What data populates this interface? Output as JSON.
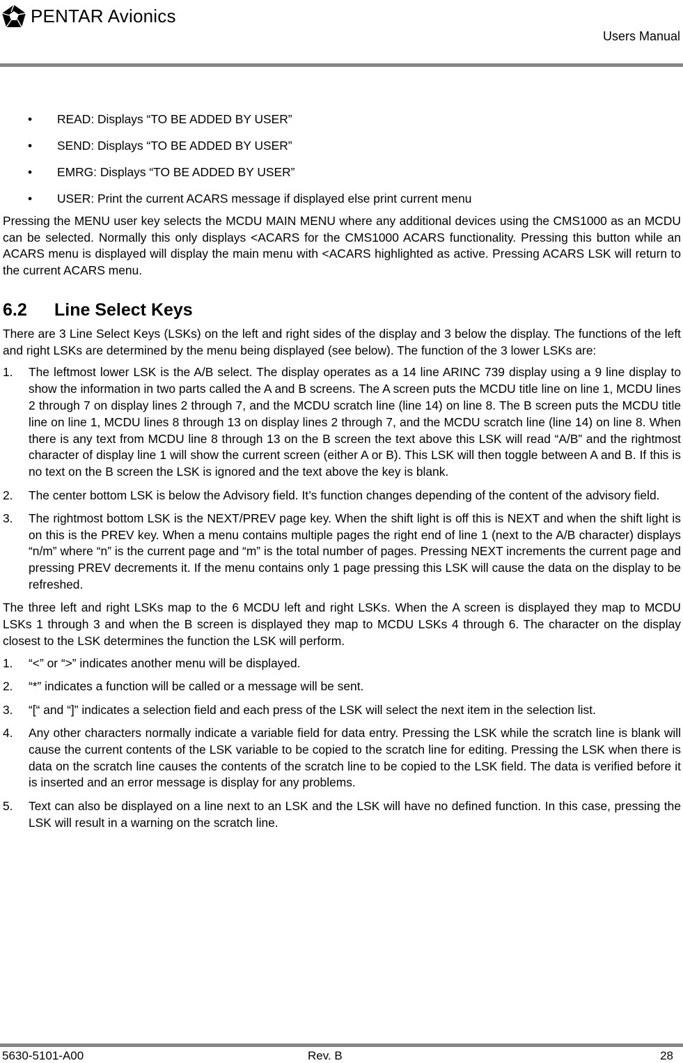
{
  "header": {
    "brand": "PENTAR Avionics",
    "logo_icon": "pentagon-aperture-logo",
    "doc_type": "Users Manual"
  },
  "bullets": [
    "READ:  Displays “TO BE ADDED BY USER”",
    "SEND:  Displays “TO BE ADDED BY USER”",
    "EMRG: Displays “TO BE ADDED BY USER”",
    "USER:  Print the current ACARS message if displayed else print current menu"
  ],
  "menu_paragraph": "Pressing the MENU user key selects the MCDU MAIN MENU where any additional devices using the CMS1000 as an MCDU can be selected.  Normally this only displays <ACARS for the CMS1000 ACARS functionality.  Pressing this button while an ACARS menu is displayed will display the main menu with <ACARS highlighted as active.  Pressing ACARS LSK will return to the current ACARS menu.",
  "section": {
    "number": "6.2",
    "title": "Line Select Keys"
  },
  "intro_paragraph": "There are 3 Line Select Keys (LSKs) on the left and right sides of the display and 3 below the display. The functions of the left and right LSKs are determined by the menu being displayed (see below).  The function of the 3 lower LSKs are:",
  "lower_lsks": [
    {
      "n": "1.",
      "text": "The leftmost lower LSK is the A/B select.  The display operates as a 14 line ARINC 739 display using a 9 line display to show the information in two parts called the A and B screens.  The A screen puts the MCDU title line on line 1, MCDU lines 2 through 7 on display lines 2 through  7, and the MCDU scratch line (line 14) on line 8. The B screen puts the MCDU title line on line 1, MCDU lines 8 through 13 on display lines 2 through  7, and the MCDU scratch line (line 14) on line 8.  When there is any text from MCDU line 8 through 13 on the B screen the text above this LSK will read “A/B” and the rightmost character of display line 1 will show the current screen (either A or B).  This LSK will then toggle between A and B.  If this is no text on the B screen the LSK is ignored and the text above the key is blank."
    },
    {
      "n": "2.",
      "text": "The center bottom LSK is below the Advisory field.  It’s function changes depending of the content of the advisory field."
    },
    {
      "n": "3.",
      "text": "The rightmost bottom LSK is the NEXT/PREV page key.  When the shift light is off this is NEXT and when the shift light is on this is the PREV key.  When a menu contains multiple pages the right end of line 1 (next to the A/B character) displays “n/m” where “n” is the current page and “m” is the total number of pages.  Pressing NEXT increments the current page and pressing PREV decrements it.  If the menu contains only 1 page pressing this LSK will cause the data on the display to be refreshed."
    }
  ],
  "mapping_paragraph": "The three left and right LSKs map to the 6 MCDU left and right LSKs.  When the A screen is displayed they map to MCDU LSKs 1 through 3 and when the B screen is displayed they map to MCDU LSKs 4 through 6.  The character on the display closest to the LSK determines the function the LSK will perform.",
  "char_functions": [
    {
      "n": "1.",
      "text": "“<” or “>” indicates another menu will be displayed."
    },
    {
      "n": "2.",
      "text": "“*” indicates a function will be called or a message will be sent."
    },
    {
      "n": "3.",
      "text": "“[“ and “]” indicates a selection field and each press of the LSK will select the next item in the selection list."
    },
    {
      "n": "4.",
      "text": "Any other characters normally indicate a variable field for data entry.  Pressing the LSK while the scratch line is blank will cause the current contents of the LSK variable to be copied to the scratch line for editing.  Pressing the LSK when there is data on the scratch line causes the contents of the scratch line to be copied to the LSK field.  The data is verified before it is inserted and an error message is display for any problems."
    },
    {
      "n": "5.",
      "text": "Text can also be displayed on a line next to an LSK and the LSK will have no defined function.  In this case, pressing the LSK will result in a warning on the scratch line."
    }
  ],
  "footer": {
    "doc_number": "5630-5101-A00",
    "revision": "Rev. B",
    "page": "28"
  },
  "colors": {
    "rule": "#858585",
    "text": "#000000"
  }
}
